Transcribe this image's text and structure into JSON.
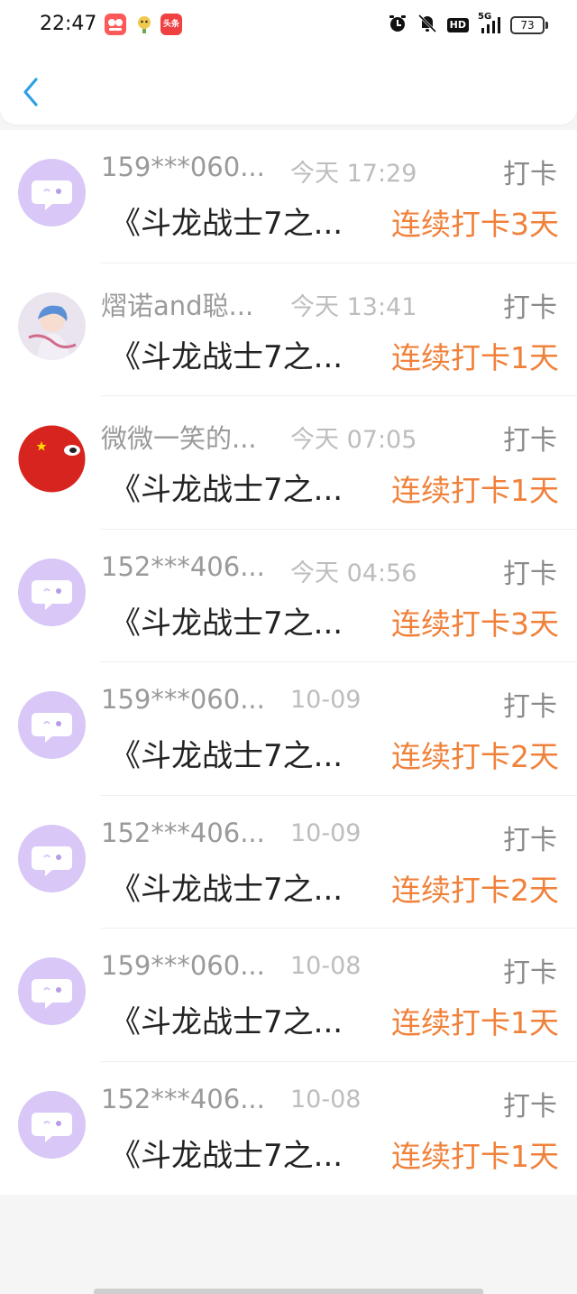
{
  "status_bar": {
    "time": "22:47",
    "app_icons": [
      {
        "name": "app-notification-icon-1",
        "label": "",
        "color": "#ff5a5a"
      },
      {
        "name": "app-notification-icon-2",
        "label": "",
        "color": "#f2c94c"
      },
      {
        "name": "app-notification-icon-3",
        "label": "头条",
        "color": "#f04142"
      }
    ],
    "network": "5G",
    "hd": "HD",
    "battery": "73"
  },
  "header": {
    "back_icon": "chevron-left-icon",
    "accent_color": "#2ea0e8"
  },
  "colors": {
    "streak": "#f0813a",
    "default_avatar": "#d9c7f7"
  },
  "items": [
    {
      "avatar": "default-avatar",
      "username": "159***060...",
      "time": "今天 17:29",
      "type": "打卡",
      "title": "《斗龙战士7之...",
      "streak": "连续打卡3天"
    },
    {
      "avatar": "anime-avatar",
      "username": "熠诺and聪...",
      "time": "今天 13:41",
      "type": "打卡",
      "title": "《斗龙战士7之...",
      "streak": "连续打卡1天"
    },
    {
      "avatar": "flag-ball-avatar",
      "username": "微微一笑的...",
      "time": "今天 07:05",
      "type": "打卡",
      "title": "《斗龙战士7之...",
      "streak": "连续打卡1天"
    },
    {
      "avatar": "default-avatar",
      "username": "152***406...",
      "time": "今天 04:56",
      "type": "打卡",
      "title": "《斗龙战士7之...",
      "streak": "连续打卡3天"
    },
    {
      "avatar": "default-avatar",
      "username": "159***060...",
      "time": "10-09",
      "type": "打卡",
      "title": "《斗龙战士7之...",
      "streak": "连续打卡2天"
    },
    {
      "avatar": "default-avatar",
      "username": "152***406...",
      "time": "10-09",
      "type": "打卡",
      "title": "《斗龙战士7之...",
      "streak": "连续打卡2天"
    },
    {
      "avatar": "default-avatar",
      "username": "159***060...",
      "time": "10-08",
      "type": "打卡",
      "title": "《斗龙战士7之...",
      "streak": "连续打卡1天"
    },
    {
      "avatar": "default-avatar",
      "username": "152***406...",
      "time": "10-08",
      "type": "打卡",
      "title": "《斗龙战士7之...",
      "streak": "连续打卡1天"
    }
  ]
}
